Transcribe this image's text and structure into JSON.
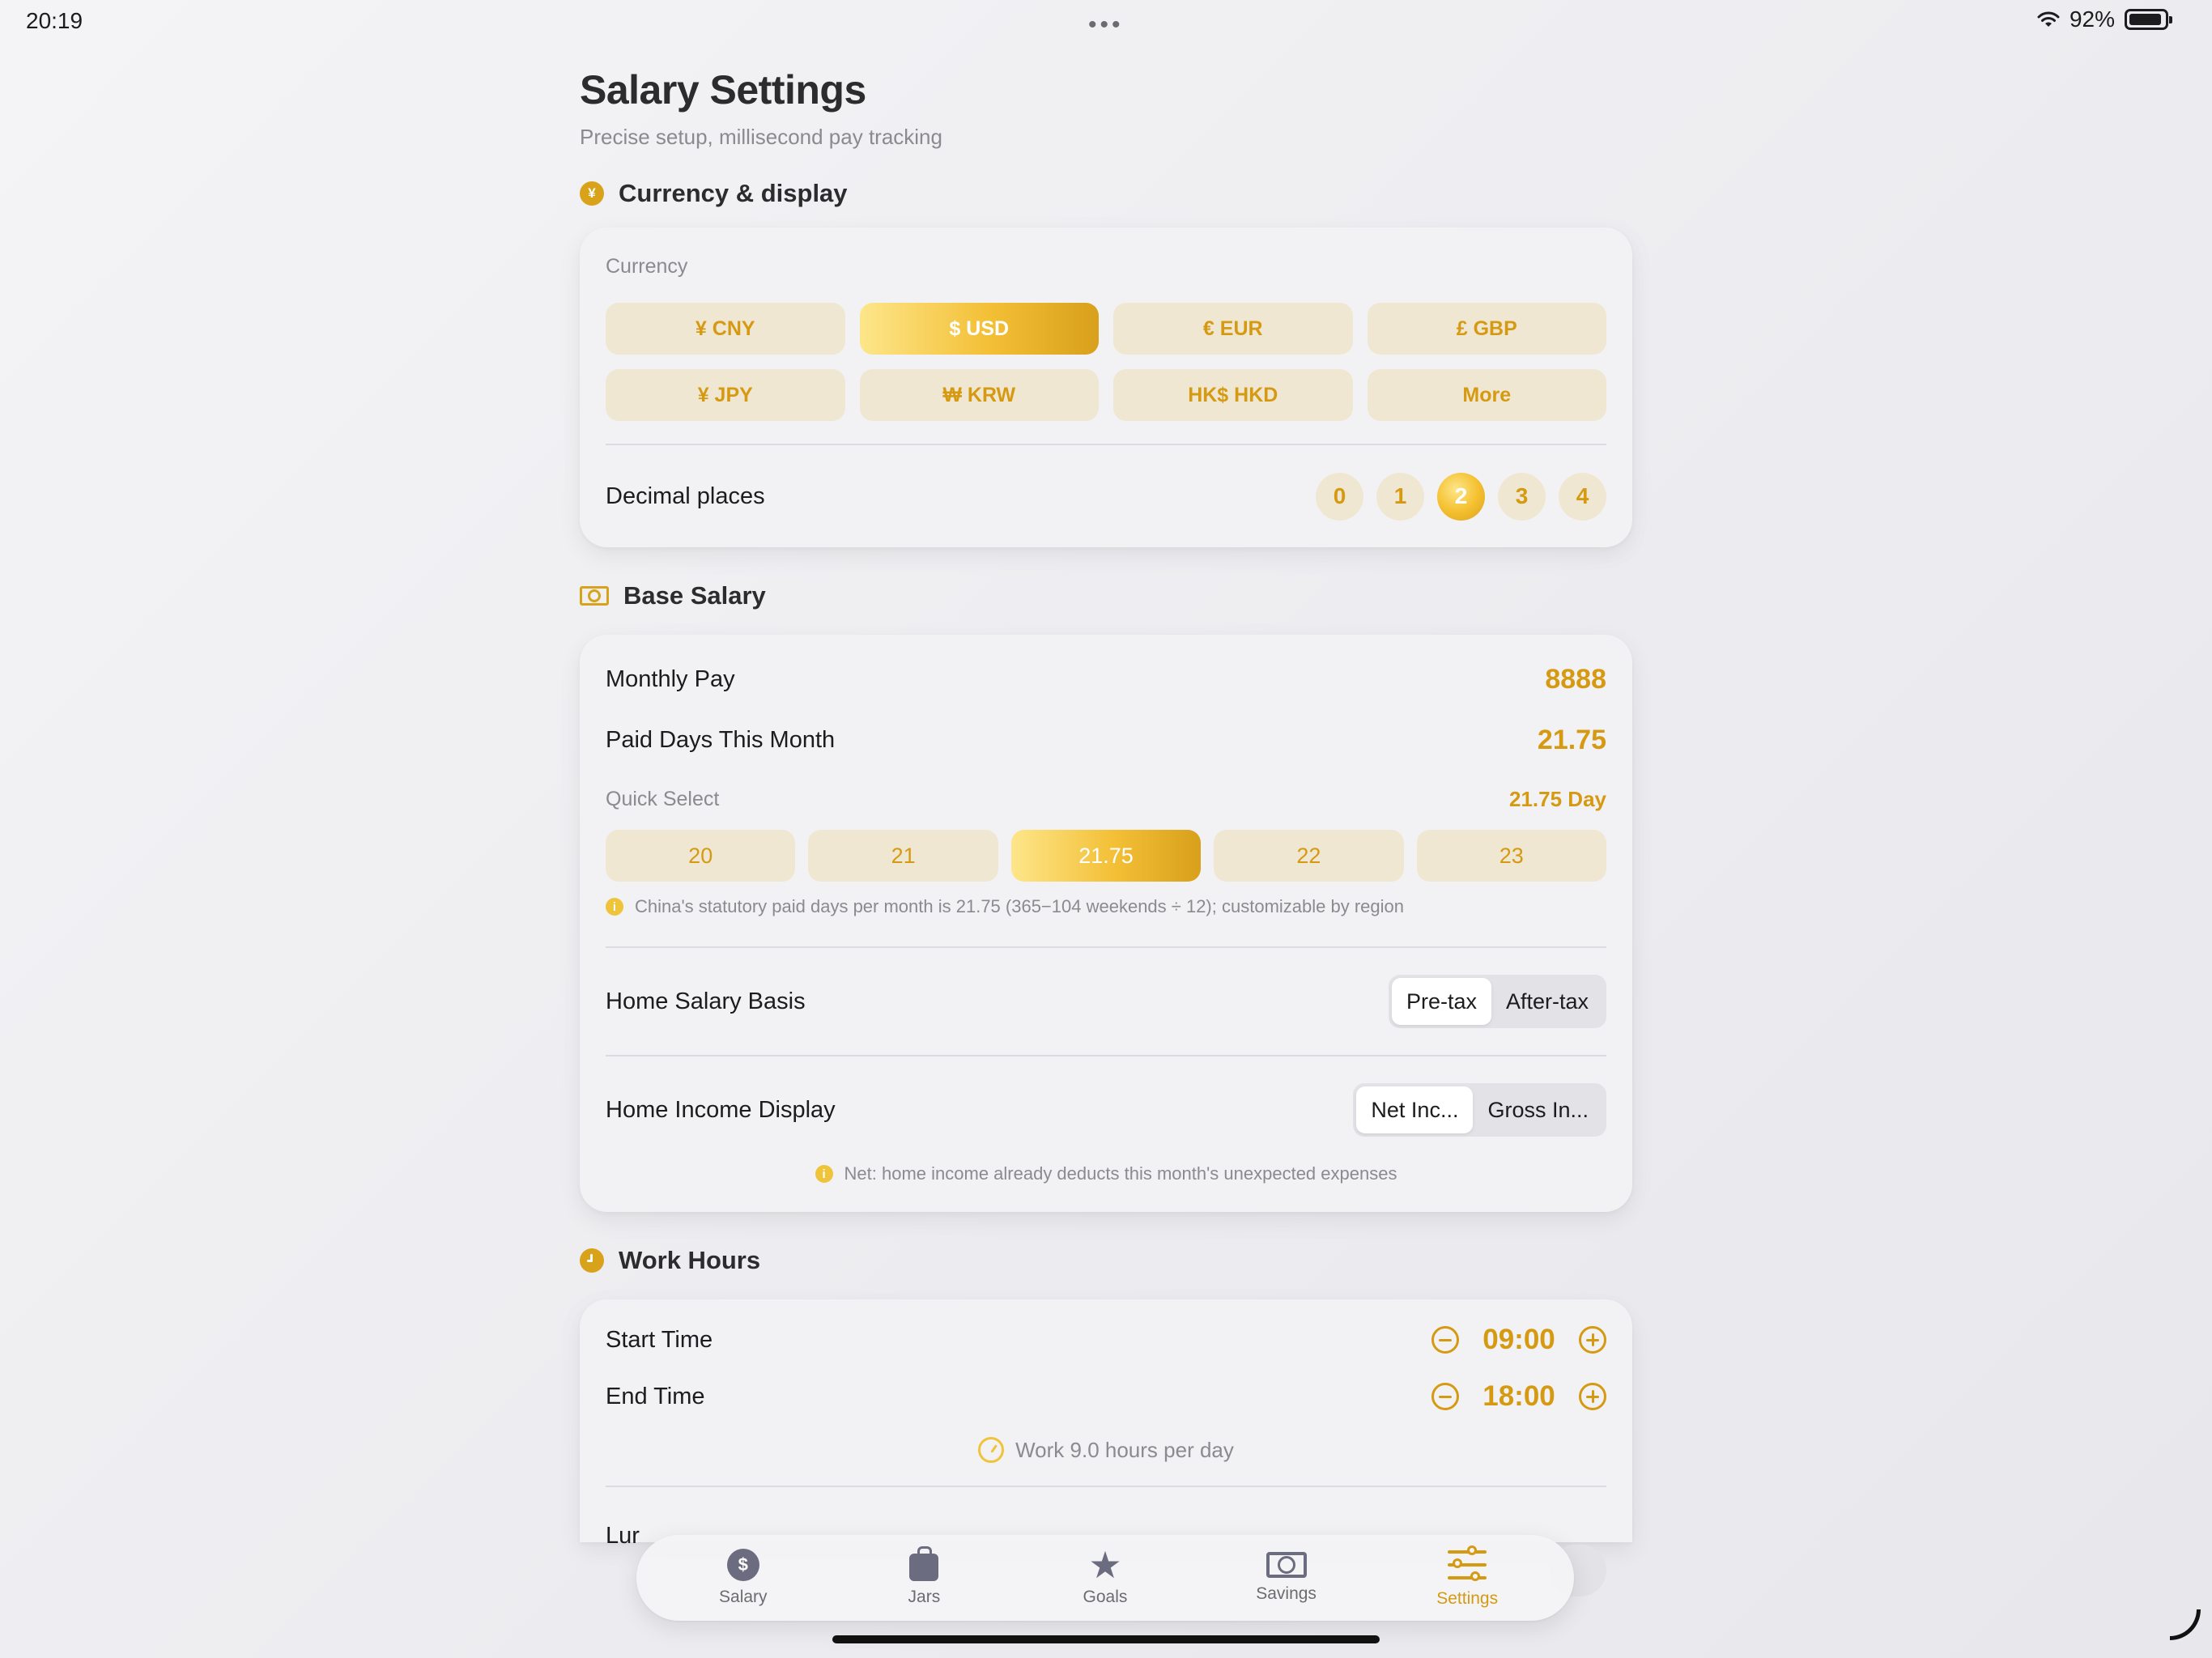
{
  "status": {
    "time": "20:19",
    "battery": "92%",
    "battery_level": 0.92
  },
  "page": {
    "title": "Salary Settings",
    "subtitle": "Precise setup, millisecond pay tracking"
  },
  "currency_section": {
    "heading": "Currency & display",
    "icon": "yen-coin-icon",
    "icon_glyph": "¥",
    "currency_label": "Currency",
    "currencies": [
      {
        "label": "¥ CNY",
        "active": false
      },
      {
        "label": "$ USD",
        "active": true
      },
      {
        "label": "€ EUR",
        "active": false
      },
      {
        "label": "£ GBP",
        "active": false
      },
      {
        "label": "¥ JPY",
        "active": false
      },
      {
        "label": "₩ KRW",
        "active": false
      },
      {
        "label": "HK$ HKD",
        "active": false
      },
      {
        "label": "More",
        "active": false
      }
    ],
    "decimal_label": "Decimal places",
    "decimals": [
      "0",
      "1",
      "2",
      "3",
      "4"
    ],
    "decimal_selected": "2"
  },
  "salary_section": {
    "heading": "Base Salary",
    "icon": "banknote-icon",
    "monthly_pay_label": "Monthly Pay",
    "monthly_pay_value": "8888",
    "paid_days_label": "Paid Days This Month",
    "paid_days_value": "21.75",
    "quick_select_label": "Quick Select",
    "quick_select_value": "21.75 Day",
    "day_options": [
      "20",
      "21",
      "21.75",
      "22",
      "23"
    ],
    "day_selected": "21.75",
    "days_note": "China's statutory paid days per month is 21.75 (365−104 weekends ÷ 12); customizable by region",
    "basis_label": "Home Salary Basis",
    "basis_options": [
      "Pre-tax",
      "After-tax"
    ],
    "basis_selected": "Pre-tax",
    "income_label": "Home Income Display",
    "income_options": [
      "Net Inc...",
      "Gross In..."
    ],
    "income_selected": "Net Inc...",
    "income_note": "Net: home income already deducts this month's unexpected expenses",
    "info_glyph": "i"
  },
  "work_section": {
    "heading": "Work Hours",
    "icon": "clock-icon",
    "start_label": "Start Time",
    "start_value": "09:00",
    "end_label": "End Time",
    "end_value": "18:00",
    "hours_summary": "Work 9.0 hours per day",
    "lunch_label_partial": "Lur"
  },
  "tabbar": {
    "tabs": [
      {
        "label": "Salary",
        "icon": "dollar-circle-icon",
        "glyph": "$",
        "active": false
      },
      {
        "label": "Jars",
        "icon": "bag-icon",
        "active": false
      },
      {
        "label": "Goals",
        "icon": "star-icon",
        "glyph": "★",
        "active": false
      },
      {
        "label": "Savings",
        "icon": "banknote-icon",
        "active": false
      },
      {
        "label": "Settings",
        "icon": "sliders-icon",
        "active": true
      }
    ]
  },
  "colors": {
    "accent": "#d69a12",
    "accent_light": "#fde68a",
    "chip_bg": "#efe7d2",
    "card_bg": "#f2f2f5"
  }
}
